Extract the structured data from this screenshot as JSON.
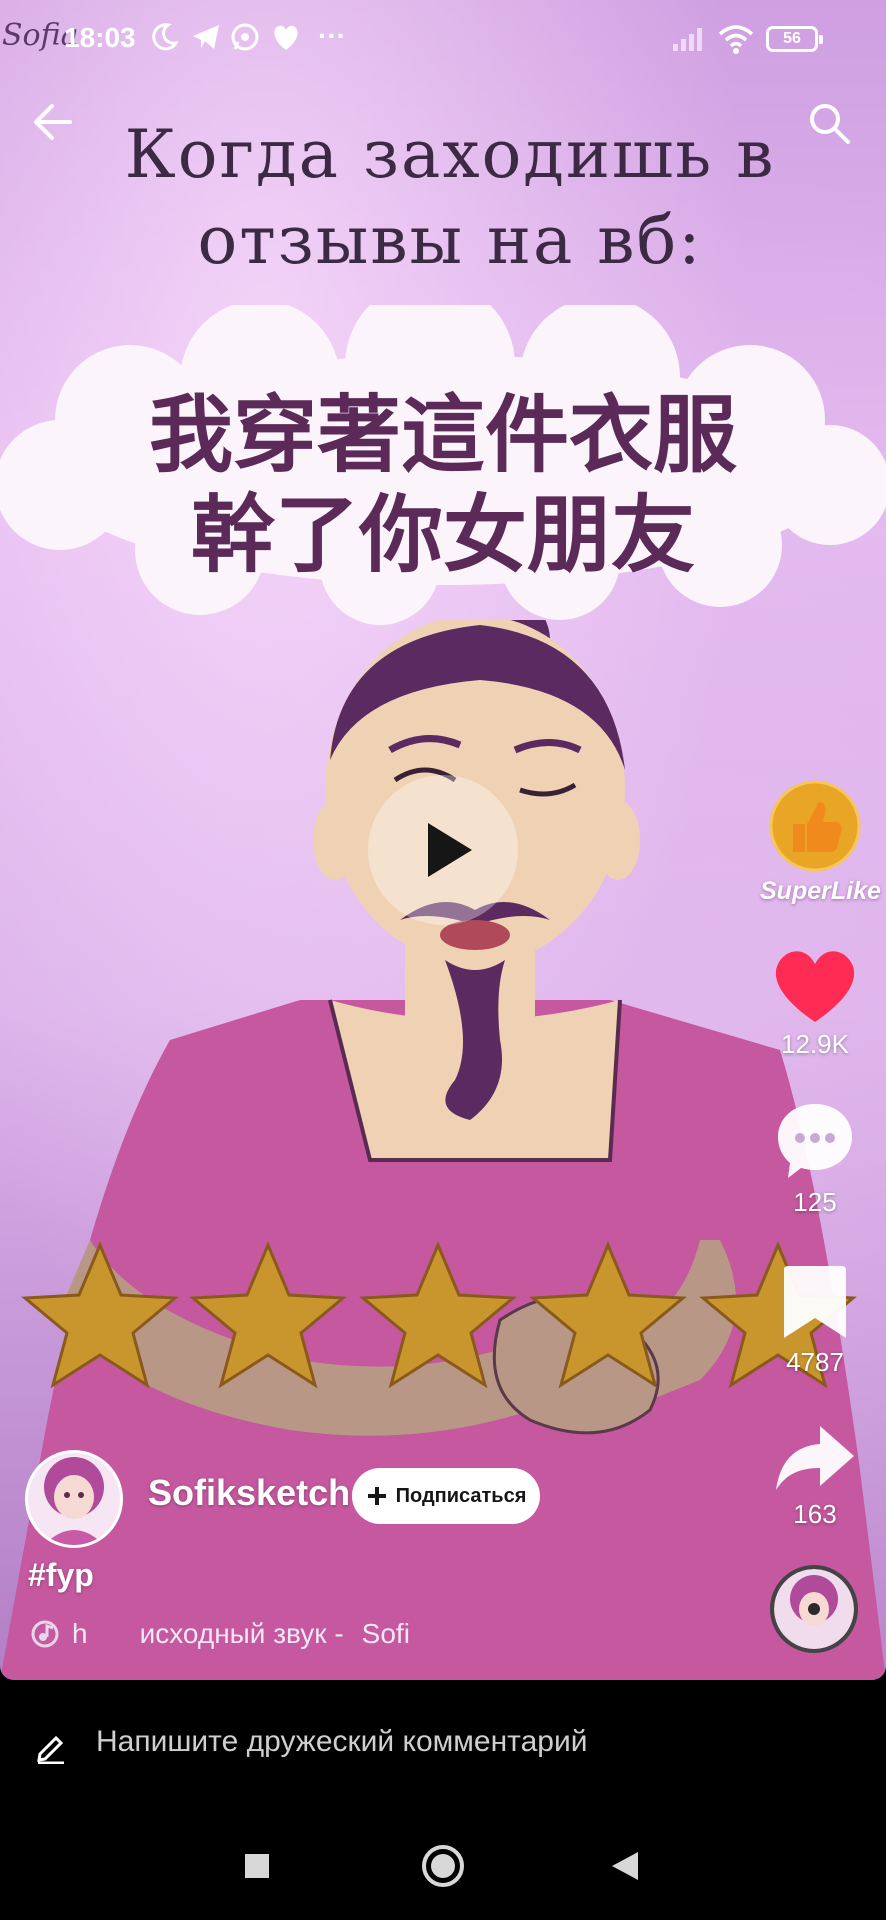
{
  "status_bar": {
    "time": "18:03",
    "battery": "56",
    "more": "···"
  },
  "video": {
    "watermark": "Sofia",
    "caption_line1": "Когда заходишь в",
    "caption_line2": "отзывы на вб:",
    "cloud_line1": "我穿著這件衣服",
    "cloud_line2": "幹了你女朋友",
    "stars_count": 5
  },
  "top_bar": {
    "back_icon": "arrow-left-icon",
    "search_icon": "search-icon"
  },
  "right_rail": {
    "superlike_label": "SuperLike",
    "like_count": "12.9K",
    "comment_count": "125",
    "bookmark_count": "4787",
    "share_count": "163"
  },
  "author": {
    "name": "Sofiksketch",
    "follow_label": "Подписаться"
  },
  "description": {
    "hashtag": "#fyp",
    "sound_prefix": "h",
    "sound_label": "исходный звук -",
    "sound_author": "Sofi"
  },
  "comment_bar": {
    "placeholder": "Напишите дружеский комментарий"
  },
  "colors": {
    "like": "#fe2c55",
    "gold": "#e8a526",
    "background": "#000000"
  }
}
